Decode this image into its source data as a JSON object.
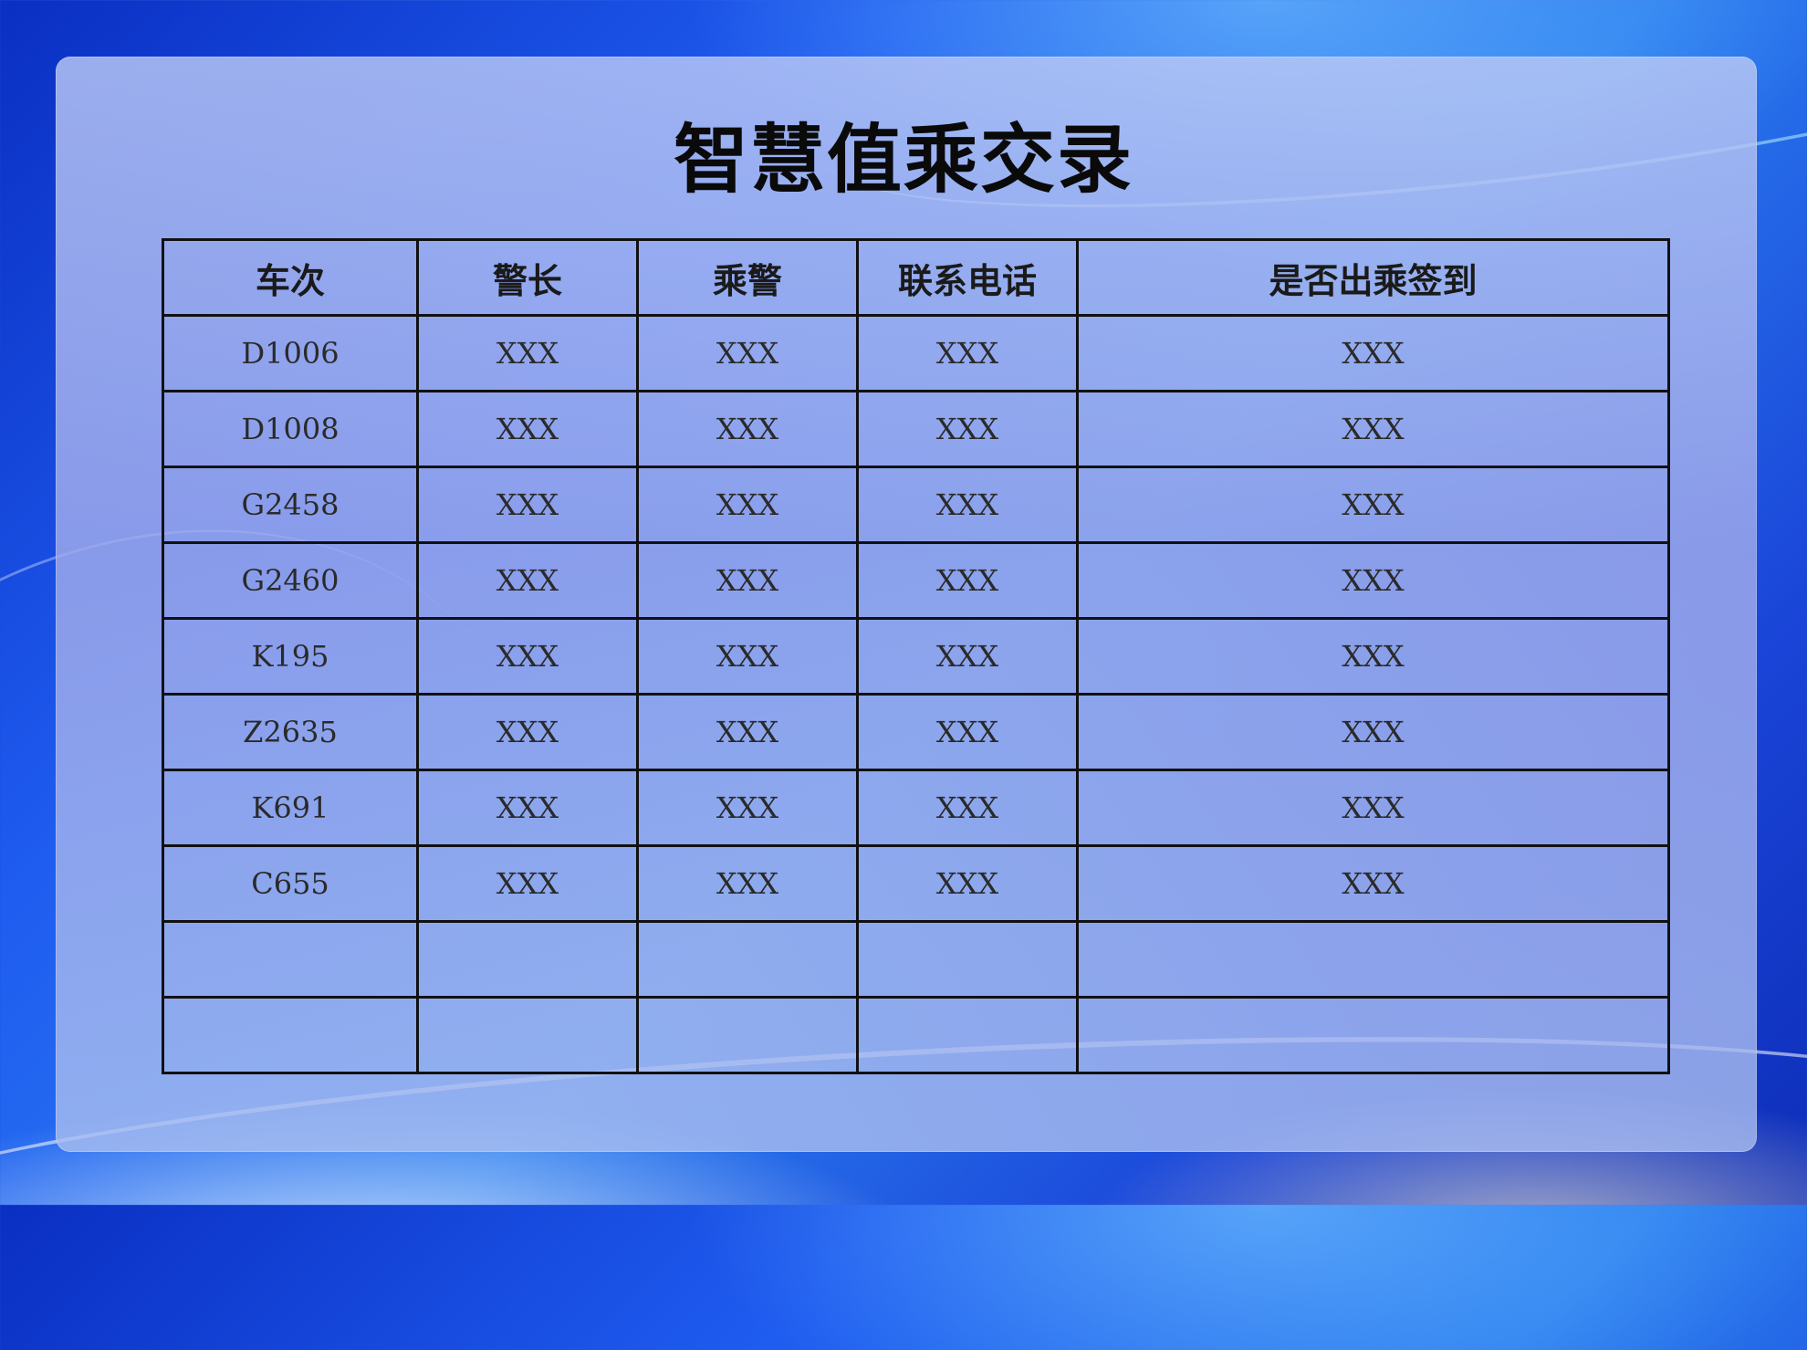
{
  "title": "智慧值乘交录",
  "table": {
    "headers": [
      "车次",
      "警长",
      "乘警",
      "联系电话",
      "是否出乘签到"
    ],
    "rows": [
      [
        "D1006",
        "XXX",
        "XXX",
        "XXX",
        "XXX"
      ],
      [
        "D1008",
        "XXX",
        "XXX",
        "XXX",
        "XXX"
      ],
      [
        "G2458",
        "XXX",
        "XXX",
        "XXX",
        "XXX"
      ],
      [
        "G2460",
        "XXX",
        "XXX",
        "XXX",
        "XXX"
      ],
      [
        "K195",
        "XXX",
        "XXX",
        "XXX",
        "XXX"
      ],
      [
        "Z2635",
        "XXX",
        "XXX",
        "XXX",
        "XXX"
      ],
      [
        "K691",
        "XXX",
        "XXX",
        "XXX",
        "XXX"
      ],
      [
        "C655",
        "XXX",
        "XXX",
        "XXX",
        "XXX"
      ],
      [
        "",
        "",
        "",
        "",
        ""
      ],
      [
        "",
        "",
        "",
        "",
        ""
      ]
    ]
  },
  "colors": {
    "background": "#1f5cf0",
    "panel": "#a9b4ee",
    "border": "#111111",
    "text": "#0a0a0a"
  }
}
